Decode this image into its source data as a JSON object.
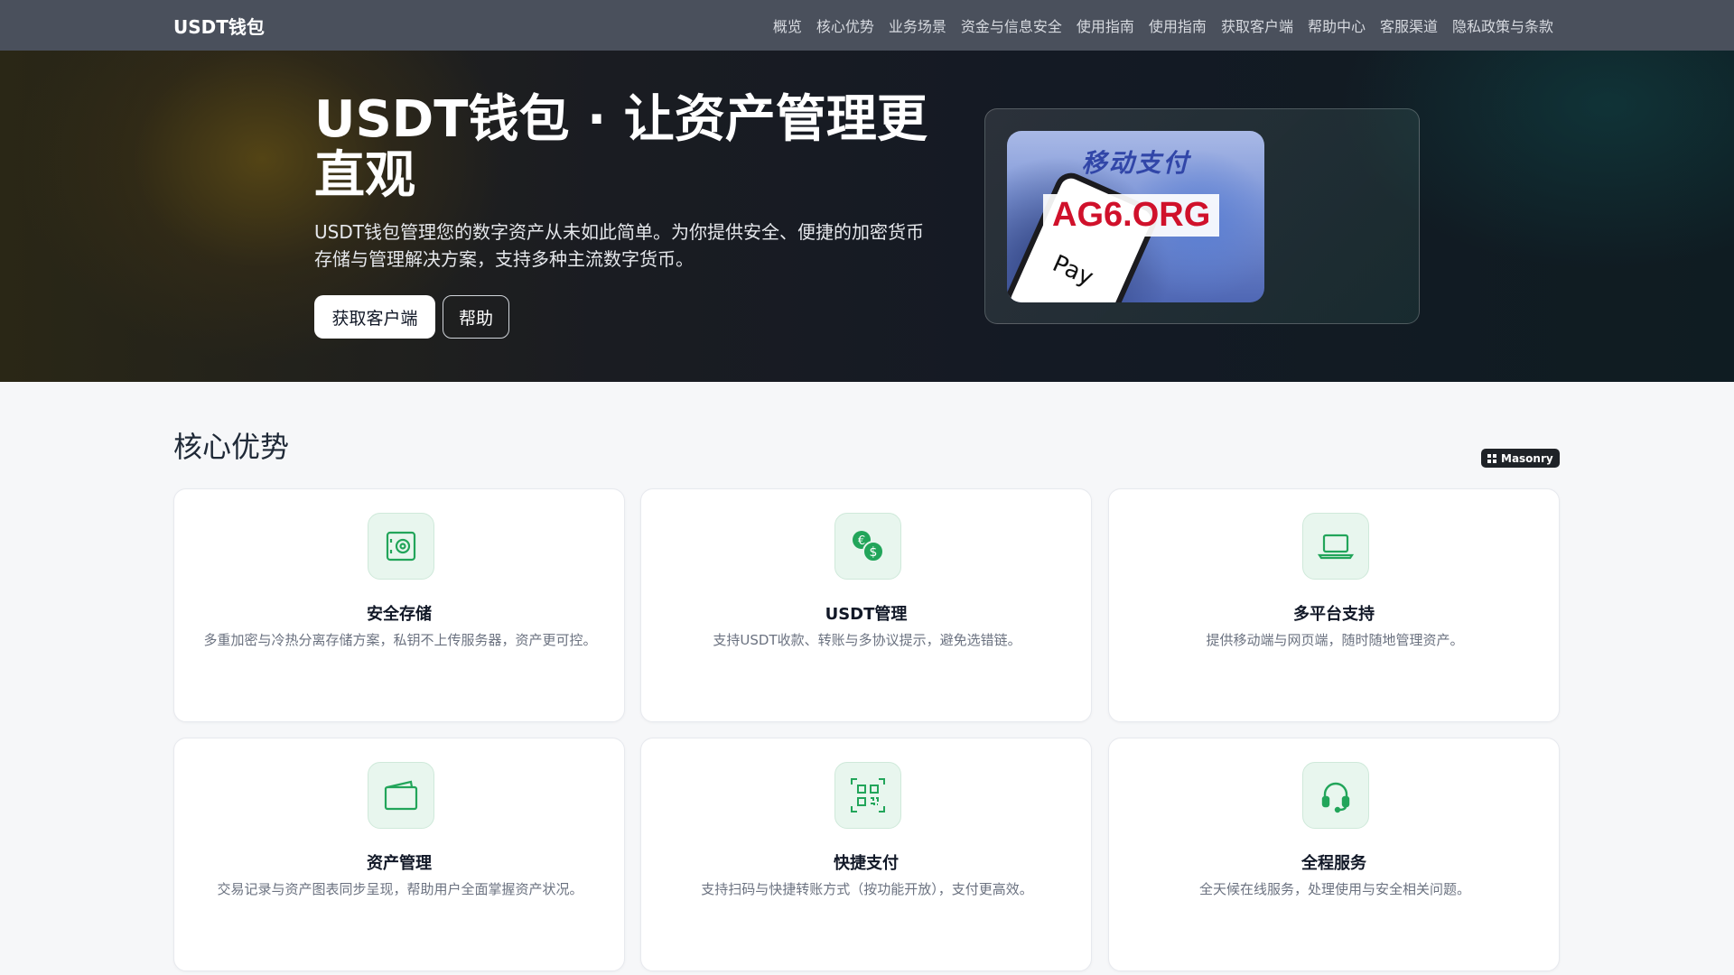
{
  "nav": {
    "brand": "USDT钱包",
    "links": [
      "概览",
      "核心优势",
      "业务场景",
      "资金与信息安全",
      "使用指南",
      "使用指南",
      "获取客户端",
      "帮助中心",
      "客服渠道",
      "隐私政策与条款"
    ]
  },
  "hero": {
    "title": "USDT钱包 · 让资产管理更直观",
    "description": "USDT钱包管理您的数字资产从未如此简单。为你提供安全、便捷的加密货币存储与管理解决方案，支持多种主流数字货币。",
    "primary_button": "获取客户端",
    "secondary_button": "帮助",
    "image": {
      "top_text": "移动支付",
      "watermark": "AG6.ORG",
      "pay_text": "Pay"
    }
  },
  "features": {
    "title": "核心优势",
    "badge": "Masonry",
    "cards": [
      {
        "icon": "safe-icon",
        "title": "安全存储",
        "desc": "多重加密与冷热分离存储方案，私钥不上传服务器，资产更可控。"
      },
      {
        "icon": "currency-exchange-icon",
        "title": "USDT管理",
        "desc": "支持USDT收款、转账与多协议提示，避免选错链。"
      },
      {
        "icon": "laptop-icon",
        "title": "多平台支持",
        "desc": "提供移动端与网页端，随时随地管理资产。"
      },
      {
        "icon": "wallet-icon",
        "title": "资产管理",
        "desc": "交易记录与资产图表同步呈现，帮助用户全面掌握资产状况。"
      },
      {
        "icon": "qr-code-icon",
        "title": "快捷支付",
        "desc": "支持扫码与快捷转账方式（按功能开放），支付更高效。"
      },
      {
        "icon": "headset-icon",
        "title": "全程服务",
        "desc": "全天候在线服务，处理使用与安全相关问题。"
      }
    ]
  },
  "colors": {
    "navbar": "#4a505c",
    "accent_green": "#22a55a",
    "icon_bg": "#e8f6ee"
  }
}
